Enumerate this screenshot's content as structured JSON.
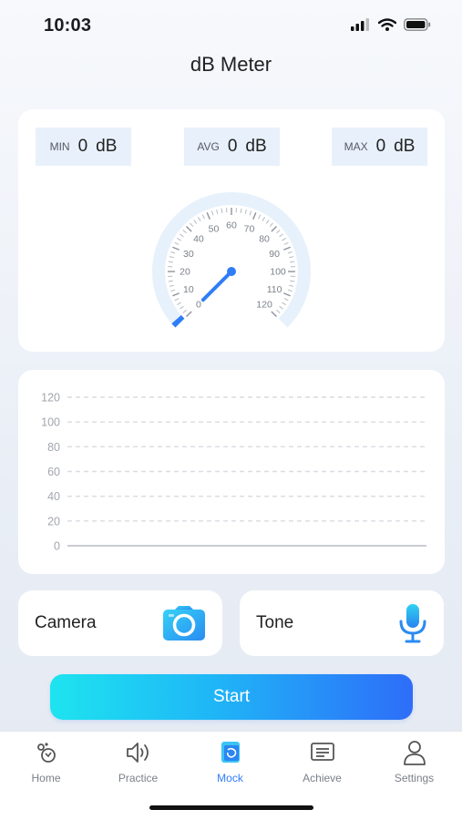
{
  "status_bar": {
    "time": "10:03"
  },
  "page": {
    "title": "dB Meter"
  },
  "stats": [
    {
      "key": "MIN",
      "value": "0",
      "unit": "dB"
    },
    {
      "key": "AVG",
      "value": "0",
      "unit": "dB"
    },
    {
      "key": "MAX",
      "value": "0",
      "unit": "dB"
    }
  ],
  "gauge": {
    "ticks": [
      "0",
      "10",
      "20",
      "30",
      "40",
      "50",
      "60",
      "70",
      "80",
      "90",
      "100",
      "110",
      "120"
    ],
    "min": 0,
    "max": 120,
    "needle_value": 0,
    "accent": "#2f7df6",
    "track": "#e6f1fb"
  },
  "chart_data": {
    "type": "line",
    "y_ticks": [
      "120",
      "100",
      "80",
      "60",
      "40",
      "20",
      "0"
    ],
    "ylim": [
      0,
      120
    ],
    "series": [],
    "grid": "dashed"
  },
  "buttons": {
    "camera_label": "Camera",
    "tone_label": "Tone",
    "start_label": "Start"
  },
  "tabbar": {
    "items": [
      {
        "label": "Home",
        "icon": "home-icon"
      },
      {
        "label": "Practice",
        "icon": "speaker-icon"
      },
      {
        "label": "Mock",
        "icon": "mock-icon"
      },
      {
        "label": "Achieve",
        "icon": "document-icon"
      },
      {
        "label": "Settings",
        "icon": "person-icon"
      }
    ],
    "active": "Mock",
    "active_color": "#2f7df6"
  }
}
